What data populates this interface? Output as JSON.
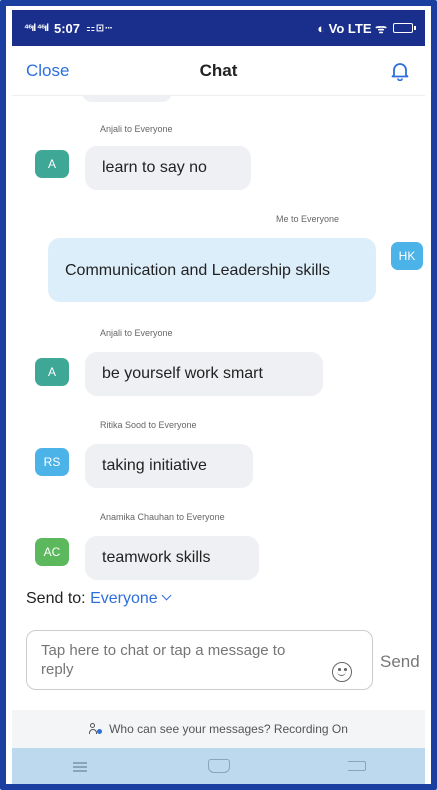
{
  "status_bar": {
    "left": "⁴⁶ıl ⁴⁶ıl 5:07 ⚏ ⊡ ···",
    "time": "5:07",
    "right": "◐ Vo LTE ᯤ"
  },
  "header": {
    "close_label": "Close",
    "title": "Chat"
  },
  "messages": [
    {
      "sender_line": "Anjali to Everyone",
      "avatar": "A",
      "avatar_color": "#3fa796",
      "text": "learn to say no",
      "mine": false
    },
    {
      "sender_line": "Me to Everyone",
      "avatar": "HK",
      "avatar_color": "#4bb3e8",
      "text": "Communication and Leadership skills",
      "mine": true
    },
    {
      "sender_line": "Anjali to Everyone",
      "avatar": "A",
      "avatar_color": "#3fa796",
      "text": "be yourself work smart",
      "mine": false
    },
    {
      "sender_line": "Ritika Sood to Everyone",
      "avatar": "RS",
      "avatar_color": "#4bb3e8",
      "text": "taking initiative",
      "mine": false
    },
    {
      "sender_line": "Anamika Chauhan to Everyone",
      "avatar": "AC",
      "avatar_color": "#5cb85c",
      "text": "teamwork skills",
      "mine": false
    }
  ],
  "send_to": {
    "label": "Send to:",
    "target": "Everyone"
  },
  "compose": {
    "placeholder": "Tap here to chat or tap a message to reply",
    "send_label": "Send"
  },
  "notice": "Who can see your messages? Recording On",
  "colors": {
    "accent": "#2d6fdc",
    "frame": "#1a3fa0",
    "status_bar": "#1a2f8c",
    "nav_bar": "#bcd9ee"
  }
}
